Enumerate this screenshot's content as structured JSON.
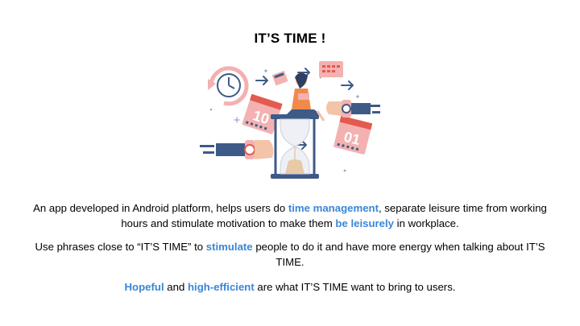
{
  "slide": {
    "title": "IT’S TIME !",
    "illustration_icon": "hourglass-time-management-illustration",
    "paragraph1": {
      "a": "An app developed in Android platform, helps users do ",
      "b": "time management",
      "c": ", separate leisure time from working hours and stimulate motivation to make them ",
      "d": "be leisurely",
      "e": " in workplace."
    },
    "paragraph2": {
      "a": "Use phrases close to “IT’S TIME” to ",
      "b": "stimulate",
      "c": " people to do it and have more energy when talking about IT’S TIME."
    },
    "paragraph3": {
      "a": "Hopeful",
      "b": " and ",
      "c": "high-efficient",
      "d": " are what IT’S TIME want to bring to users."
    },
    "colors": {
      "highlight": "#3a86d8",
      "illustration_pink": "#f3b1b1",
      "illustration_red": "#e35a4e",
      "illustration_blue": "#3e5a86",
      "illustration_orange": "#f08a4b",
      "text": "#000000",
      "background": "#ffffff"
    }
  }
}
